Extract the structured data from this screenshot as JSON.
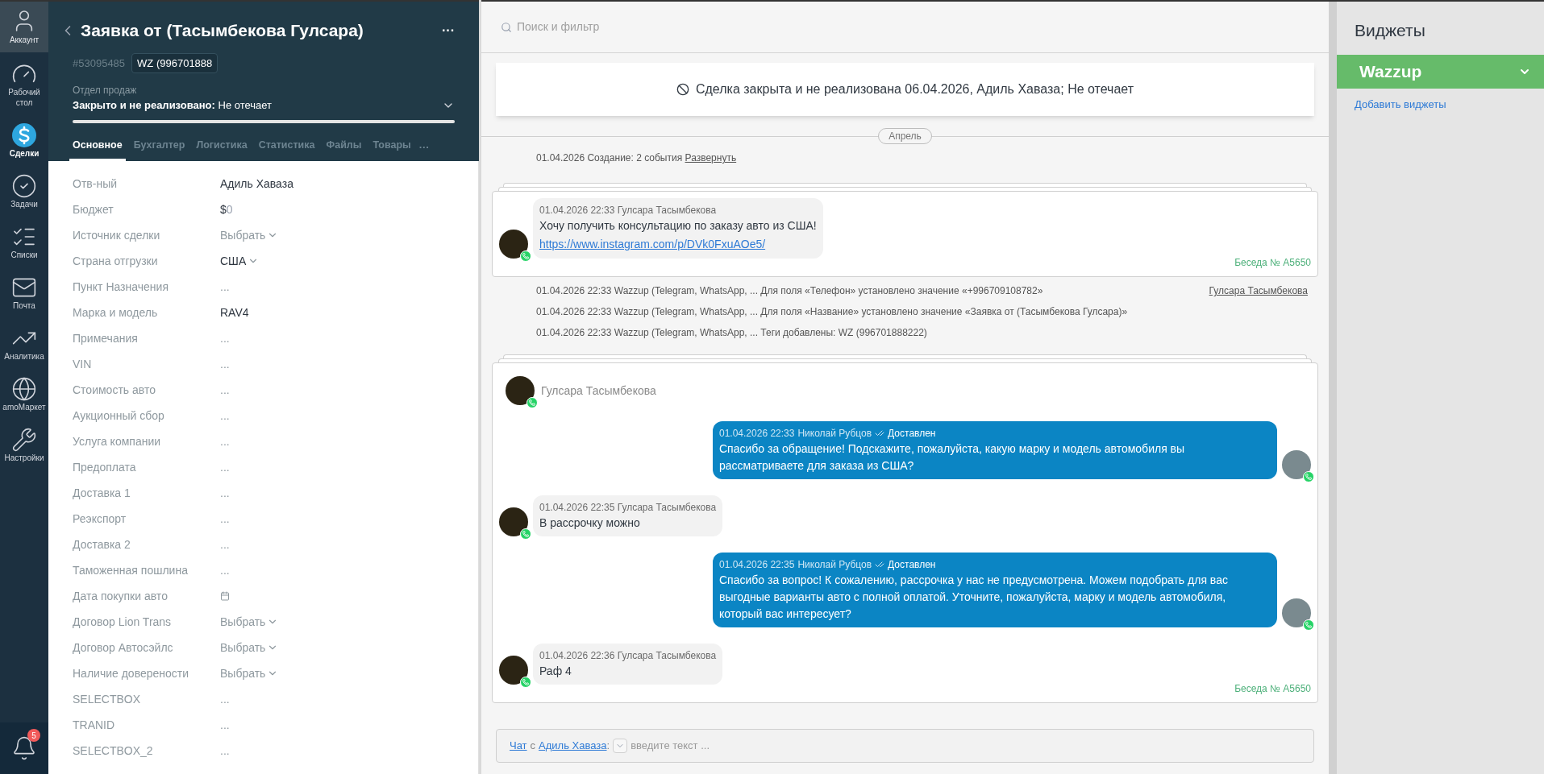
{
  "nav": {
    "items": [
      {
        "kind": "account",
        "label": "Аккаунт",
        "selected": false
      },
      {
        "kind": "dashboard",
        "label": "Рабочий стол",
        "selected": false
      },
      {
        "kind": "deals",
        "label": "Сделки",
        "selected": true
      },
      {
        "kind": "tasks",
        "label": "Задачи",
        "selected": false
      },
      {
        "kind": "lists",
        "label": "Списки",
        "selected": false
      },
      {
        "kind": "mail",
        "label": "Почта",
        "selected": false
      },
      {
        "kind": "analytics",
        "label": "Аналитика",
        "selected": false
      },
      {
        "kind": "market",
        "label": "amoМаркет",
        "selected": false
      },
      {
        "kind": "settings",
        "label": "Настройки",
        "selected": false
      }
    ],
    "notifications": {
      "count": "5"
    }
  },
  "lead": {
    "title": "Заявка от (Тасымбекова Гулсара)",
    "more": "···",
    "id": "#53095485",
    "tag": "WZ (996701888",
    "pipeline": "Отдел продаж",
    "progress": {
      "level": 1
    },
    "status_label": "Закрыто и не реализовано:",
    "status_value": "Не отечает",
    "tabs": [
      {
        "label": "Основное",
        "selected": true
      },
      {
        "label": "Бухгалтер",
        "selected": false
      },
      {
        "label": "Логистика",
        "selected": false
      },
      {
        "label": "Статистика",
        "selected": false
      },
      {
        "label": "Файлы",
        "selected": false
      },
      {
        "label": "Товары",
        "selected": false
      }
    ],
    "tabs_more": "···",
    "fields": [
      {
        "label": "Отв-ный",
        "kind": "text",
        "value": "Адиль Хаваза"
      },
      {
        "label": "Бюджет",
        "kind": "money",
        "value": "$",
        "placeholder": "0"
      },
      {
        "label": "Источник сделки",
        "kind": "select",
        "placeholder": "Выбрать"
      },
      {
        "label": "Страна отгрузки",
        "kind": "select_set",
        "value": "США"
      },
      {
        "label": "Пункт Назначения",
        "kind": "empty",
        "value": "..."
      },
      {
        "label": "Марка и модель",
        "kind": "text",
        "value": "RAV4"
      },
      {
        "label": "Примечания",
        "kind": "empty",
        "value": "..."
      },
      {
        "label": "VIN",
        "kind": "empty",
        "value": "..."
      },
      {
        "label": "Стоимость авто",
        "kind": "empty",
        "value": "..."
      },
      {
        "label": "Аукционный сбор",
        "kind": "empty",
        "value": "..."
      },
      {
        "label": "Услуга компании",
        "kind": "empty",
        "value": "..."
      },
      {
        "label": "Предоплата",
        "kind": "empty",
        "value": "..."
      },
      {
        "label": "Доставка 1",
        "kind": "empty",
        "value": "..."
      },
      {
        "label": "Реэкспорт",
        "kind": "empty",
        "value": "..."
      },
      {
        "label": "Доставка 2",
        "kind": "empty",
        "value": "..."
      },
      {
        "label": "Таможенная пошлина",
        "kind": "empty",
        "value": "..."
      },
      {
        "label": "Дата покупки авто",
        "kind": "date"
      },
      {
        "label": "Договор Lion Trans",
        "kind": "select",
        "placeholder": "Выбрать"
      },
      {
        "label": "Договор Автосэйлс",
        "kind": "select",
        "placeholder": "Выбрать"
      },
      {
        "label": "Наличие доверености",
        "kind": "select",
        "placeholder": "Выбрать"
      },
      {
        "label": "SELECTBOX",
        "kind": "empty",
        "value": "..."
      },
      {
        "label": "TRANID",
        "kind": "empty",
        "value": "..."
      },
      {
        "label": "SELECTBOX_2",
        "kind": "empty",
        "value": "..."
      }
    ]
  },
  "feed": {
    "search": {
      "placeholder": "Поиск и фильтр"
    },
    "closed_banner": "Сделка закрыта и не реализована 06.04.2026, Адиль Хаваза; Не отечает",
    "month": "Апрель",
    "items": [
      {
        "kind": "summary",
        "text": "01.04.2026 Создание: 2 события",
        "link": "Развернуть"
      },
      {
        "kind": "card",
        "footer": "Беседа № A5650",
        "messages": [
          {
            "kind": "incoming",
            "meta": "01.04.2026 22:33 Гулсара Тасымбекова",
            "text": "Хочу получить консультацию по заказу авто из США!",
            "link": "https://www.instagram.com/p/DVk0FxuAOe5/"
          }
        ]
      },
      {
        "kind": "event",
        "text": "01.04.2026 22:33 Wazzup (Telegram, WhatsApp, ... Для поля «Телефон» установлено значение «+996709108782»",
        "author": "Гулсара Тасымбекова"
      },
      {
        "kind": "event",
        "text": "01.04.2026 22:33 Wazzup (Telegram, WhatsApp, ... Для поля «Название» установлено значение «Заявка от (Тасымбекова Гулсара)»"
      },
      {
        "kind": "event",
        "text": "01.04.2026 22:33 Wazzup (Telegram, WhatsApp, ... Теги добавлены: WZ (996701888222)"
      },
      {
        "kind": "card",
        "header": "Гулсара Тасымбекова",
        "footer": "Беседа № A5650",
        "messages": [
          {
            "kind": "outgoing",
            "time": "01.04.2026 22:33",
            "author": "Николай Рубцов",
            "status": "Доставлен",
            "text": "Спасибо за обращение! Подскажите, пожалуйста, какую марку и модель автомобиля вы рассматриваете для заказа из США?"
          },
          {
            "kind": "incoming",
            "meta": "01.04.2026 22:35 Гулсара Тасымбекова",
            "text": "В рассрочку можно"
          },
          {
            "kind": "outgoing",
            "time": "01.04.2026 22:35",
            "author": "Николай Рубцов",
            "status": "Доставлен",
            "text": "Спасибо за вопрос! К сожалению, рассрочка у нас не предусмотрена. Можем подобрать для вас выгодные варианты авто с полной оплатой. Уточните, пожалуйста, марку и модель автомобиля, который вас интересует?"
          },
          {
            "kind": "incoming",
            "meta": "01.04.2026 22:36 Гулсара Тасымбекова",
            "text": "Раф 4"
          }
        ]
      }
    ],
    "composer": {
      "chat_link": "Чат",
      "with": "с",
      "recipient": "Адиль Хаваза",
      "colon": ":",
      "placeholder": "введите текст ..."
    }
  },
  "widgets": {
    "title": "Виджеты",
    "items": [
      {
        "name": "Wazzup",
        "expanded": false
      }
    ],
    "add_link": "Добавить виджеты"
  }
}
